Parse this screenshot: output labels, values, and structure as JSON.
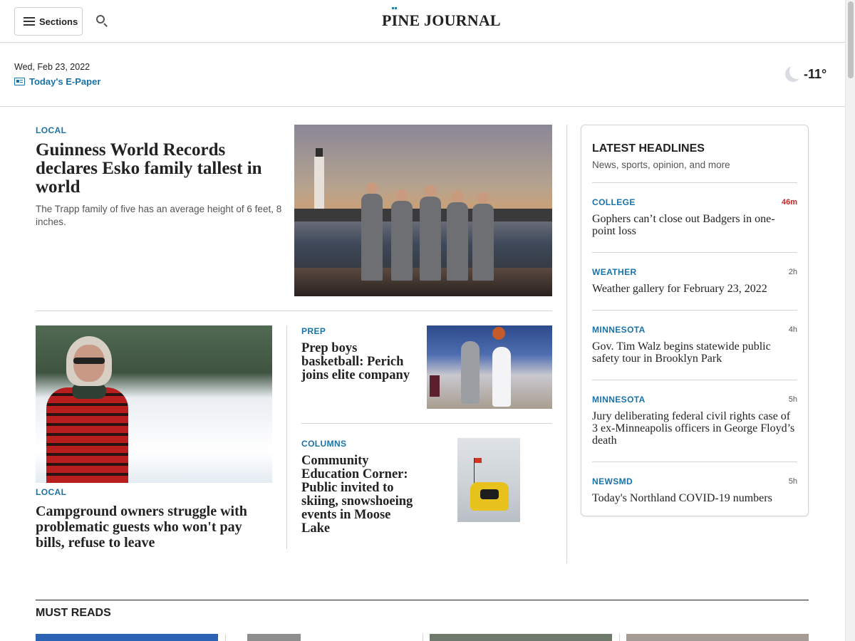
{
  "nav": {
    "sections_label": "Sections",
    "logo_text": "PINE JOURNAL"
  },
  "datebar": {
    "date": "Wed, Feb 23, 2022",
    "epaper_label": "Today's E-Paper",
    "temperature": "-11°"
  },
  "lead": {
    "kicker": "LOCAL",
    "headline": "Guinness World Records declares Esko family tallest in world",
    "summary": "The Trapp family of five has an average height of 6 feet, 8 inches."
  },
  "story2": {
    "kicker": "LOCAL",
    "headline": "Campground owners struggle with problematic guests who won't pay bills, refuse to leave"
  },
  "story3": {
    "kicker": "PREP",
    "headline": "Prep boys basketball: Perich joins elite company"
  },
  "story4": {
    "kicker": "COLUMNS",
    "headline": "Community Education Corner: Public invited to skiing, snowshoeing events in Moose Lake"
  },
  "latest": {
    "title": "LATEST HEADLINES",
    "subtitle": "News, sports, opinion, and more",
    "items": [
      {
        "kicker": "COLLEGE",
        "time": "46m",
        "headline": "Gophers can’t close out Badgers in one-point loss"
      },
      {
        "kicker": "WEATHER",
        "time": "2h",
        "headline": "Weather gallery for February 23, 2022"
      },
      {
        "kicker": "MINNESOTA",
        "time": "4h",
        "headline": "Gov. Tim Walz begins statewide public safety tour in Brooklyn Park"
      },
      {
        "kicker": "MINNESOTA",
        "time": "5h",
        "headline": "Jury deliberating federal civil rights case of 3 ex-Minneapolis officers in George Floyd’s death"
      },
      {
        "kicker": "NEWSMD",
        "time": "5h",
        "headline": "Today's Northland COVID-19 numbers"
      }
    ]
  },
  "must_reads": {
    "title": "MUST READS"
  },
  "colors": {
    "accent": "#1a73a8",
    "fresh_time": "#c62828",
    "text": "#222222"
  }
}
